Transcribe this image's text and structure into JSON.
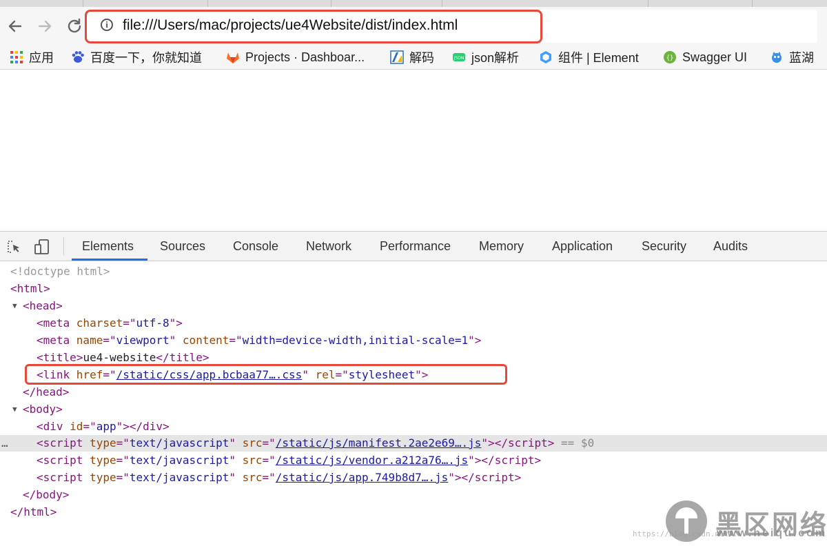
{
  "browser": {
    "url": "file:///Users/mac/projects/ue4Website/dist/index.html",
    "nav": {
      "back_icon": "arrow-left-icon",
      "forward_icon": "arrow-right-icon",
      "reload_icon": "reload-icon",
      "info_icon": "info-icon"
    },
    "bookmarks": [
      {
        "label": "应用",
        "icon": "apps-grid-icon"
      },
      {
        "label": "百度一下，你就知道",
        "icon": "baidu-paw-icon"
      },
      {
        "label": "Projects · Dashboar...",
        "icon": "gitlab-fox-icon"
      },
      {
        "label": "解码",
        "icon": "decode-icon"
      },
      {
        "label": "json解析",
        "icon": "json-icon"
      },
      {
        "label": "组件 | Element",
        "icon": "element-icon"
      },
      {
        "label": "Swagger UI",
        "icon": "swagger-icon"
      },
      {
        "label": "蓝湖",
        "icon": "lanhu-icon"
      }
    ]
  },
  "devtools": {
    "tools": {
      "inspect_icon": "inspect-element-icon",
      "device_icon": "device-toggle-icon"
    },
    "tabs": [
      "Elements",
      "Sources",
      "Console",
      "Network",
      "Performance",
      "Memory",
      "Application",
      "Security",
      "Audits"
    ],
    "active_tab": "Elements",
    "dom": {
      "doctype": "<!doctype html>",
      "html_open": "html",
      "head_open": "head",
      "meta_charset": {
        "attr": "charset",
        "value": "utf-8"
      },
      "meta_viewport": {
        "name_attr": "name",
        "name_value": "viewport",
        "content_attr": "content",
        "content_value": "width=device-width,initial-scale=1"
      },
      "title": {
        "tag": "title",
        "text": "ue4-website"
      },
      "link": {
        "href_attr": "href",
        "href": "/static/css/app.bcbaa77….css",
        "rel_attr": "rel",
        "rel": "stylesheet"
      },
      "body_open": "body",
      "div": {
        "id_attr": "id",
        "id": "app"
      },
      "scripts": [
        {
          "type": "text/javascript",
          "src": "/static/js/manifest.2ae2e69….js"
        },
        {
          "type": "text/javascript",
          "src": "/static/js/vendor.a212a76….js"
        },
        {
          "type": "text/javascript",
          "src": "/static/js/app.749b8d7….js"
        }
      ],
      "selected_marker": "== $0"
    }
  },
  "watermark": {
    "text": "黑区网络",
    "url": "www.heiqu.com",
    "faint": "https://blog.csdn.net/..."
  },
  "colors": {
    "highlight_border": "#e8483a",
    "active_tab_underline": "#1a73e8",
    "tag": "#881280",
    "attr_name": "#994500",
    "attr_value": "#1a1aa6"
  }
}
